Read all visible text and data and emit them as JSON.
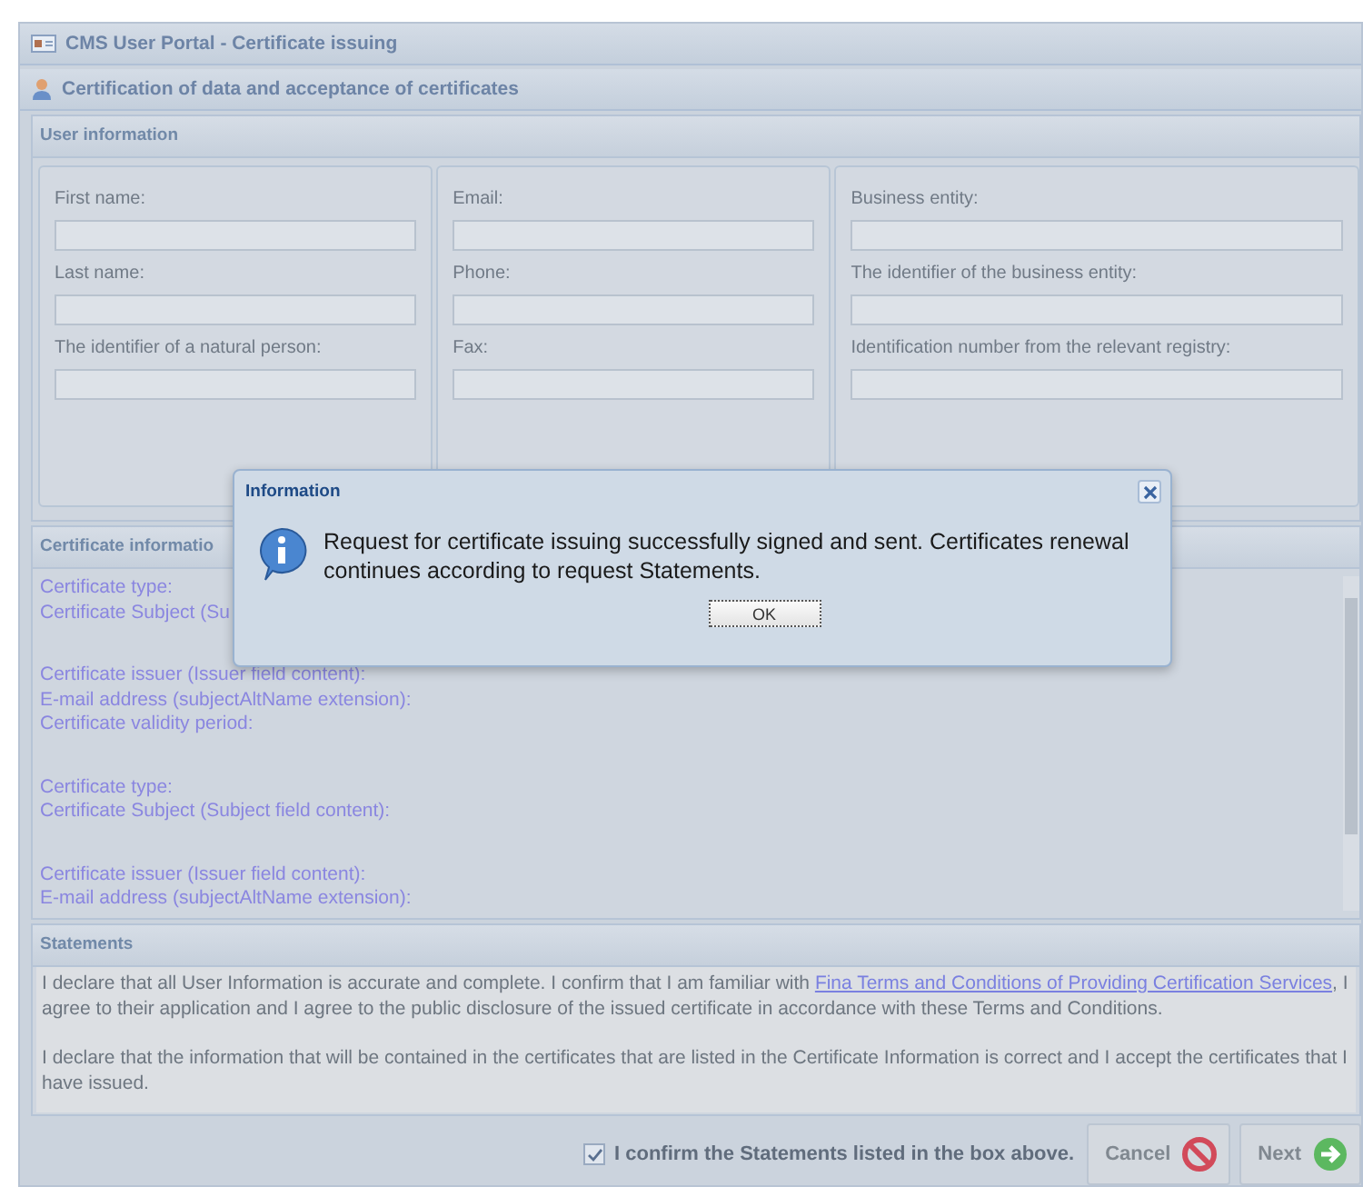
{
  "window": {
    "title": "CMS User Portal - Certificate issuing"
  },
  "section": {
    "title": "Certification of data and acceptance of certificates"
  },
  "user_info": {
    "title": "User information",
    "columns": [
      {
        "fields": [
          {
            "label": "First name:"
          },
          {
            "label": "Last name:"
          },
          {
            "label": "The identifier of a natural person:"
          }
        ]
      },
      {
        "fields": [
          {
            "label": "Email:"
          },
          {
            "label": "Phone:"
          },
          {
            "label": "Fax:"
          }
        ]
      },
      {
        "fields": [
          {
            "label": "Business entity:"
          },
          {
            "label": "The identifier of the business entity:"
          },
          {
            "label": "Identification number from the relevant registry:"
          }
        ]
      }
    ]
  },
  "certificate_info": {
    "title": "Certificate informatio",
    "groups": [
      {
        "lines": [
          "Certificate type:",
          "Certificate Subject (Su"
        ]
      },
      {
        "lines": [
          "Certificate issuer (Issuer field content):",
          "E-mail address (subjectAltName extension):",
          "Certificate validity period:"
        ]
      },
      {
        "lines": [
          "Certificate type:",
          "Certificate Subject (Subject field content):"
        ]
      },
      {
        "lines": [
          "Certificate issuer (Issuer field content):",
          "E-mail address (subjectAltName extension):"
        ]
      }
    ]
  },
  "statements": {
    "title": "Statements",
    "paragraphs": [
      {
        "before": "I declare that all User Information is accurate and complete. I confirm that I am familiar with ",
        "link": "Fina Terms and Conditions of Providing Certification Services",
        "after": ", I agree to their application and I agree to the public disclosure of the issued certificate in accordance with these Terms and Conditions."
      },
      {
        "before": "I declare that the information that will be contained in the certificates that are listed in the Certificate Information is correct and I accept the certificates that I have issued."
      }
    ]
  },
  "footer": {
    "confirm": {
      "label": "I confirm the Statements listed in the box above.",
      "checked": true
    },
    "buttons": [
      {
        "label": "Cancel",
        "kind": "cancel"
      },
      {
        "label": "Next",
        "kind": "next"
      }
    ]
  },
  "dialog": {
    "title": "Information",
    "message": "Request for certificate issuing successfully signed and sent. Certificates renewal continues according to request Statements.",
    "button": "OK"
  }
}
